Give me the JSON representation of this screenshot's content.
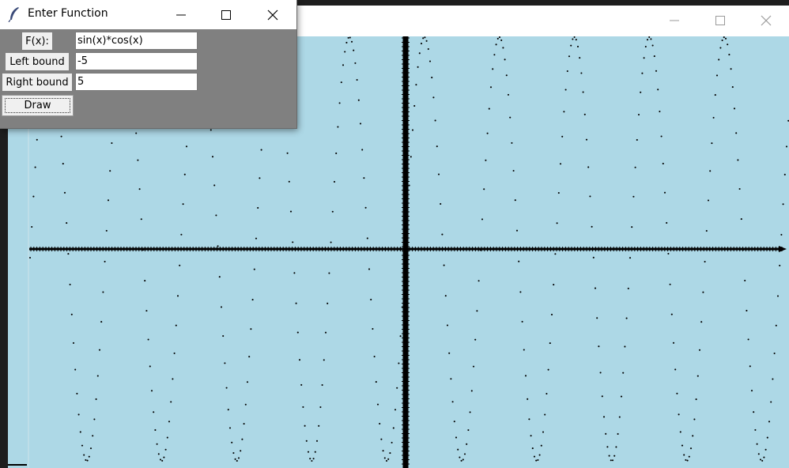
{
  "dialog": {
    "title": "Enter Function",
    "fx_label": "F(x):",
    "fx_value": "sin(x)*cos(x)",
    "left_label": "Left bound",
    "left_value": "-5",
    "right_label": "Right bound",
    "right_value": "5",
    "draw_label": "Draw"
  },
  "main_window": {
    "canvas_color": "#add8e6"
  },
  "colors": {
    "canvas": "#add8e6",
    "dialog_bg": "#808080",
    "plot": "#000000"
  },
  "chart_data": {
    "type": "scatter",
    "function": "sin(x)*cos(x)",
    "xlim": [
      -5,
      5
    ],
    "ylim": [
      -0.5,
      0.5
    ]
  }
}
